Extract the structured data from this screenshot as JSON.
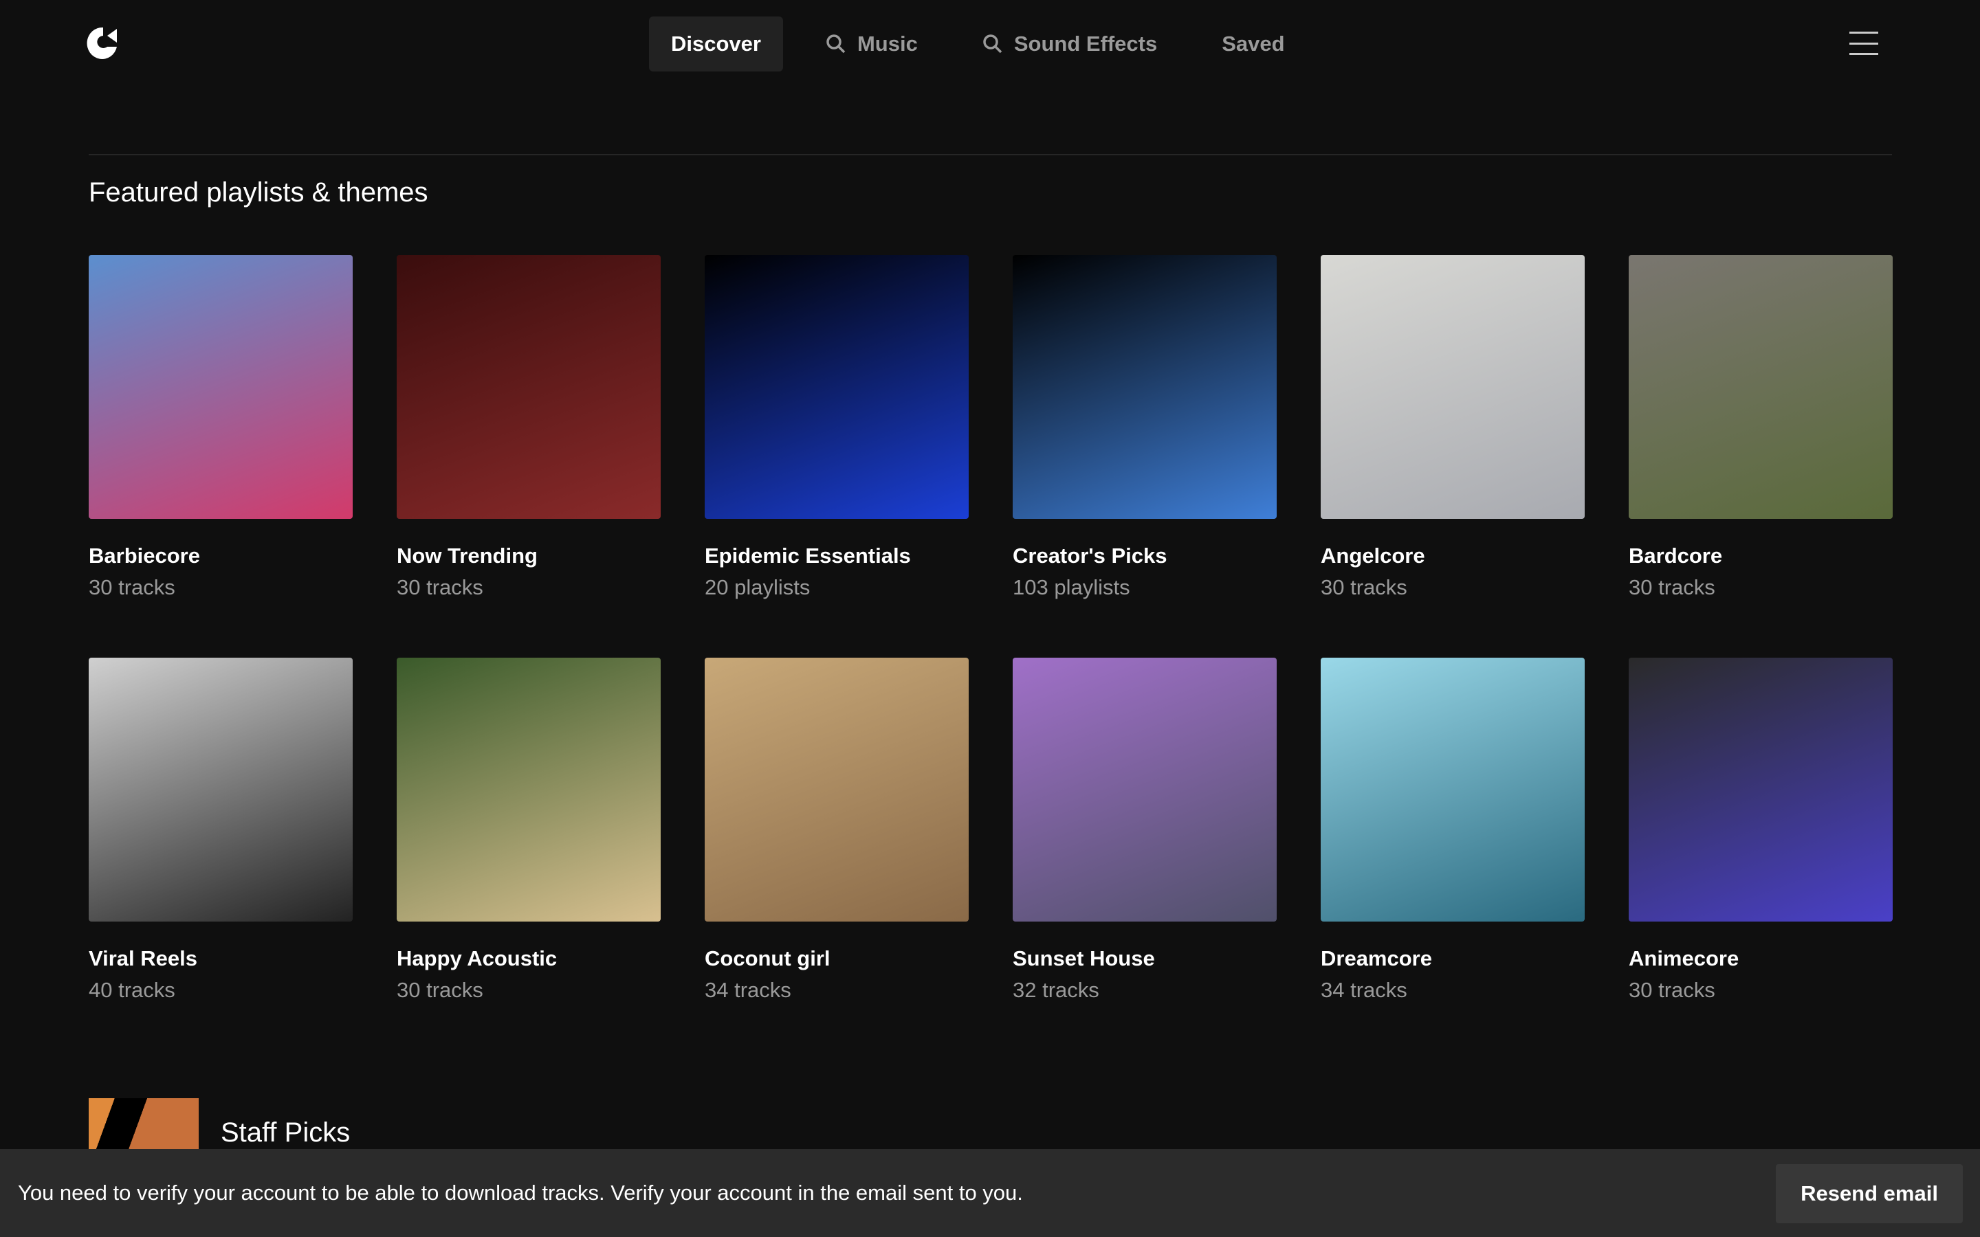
{
  "nav": {
    "items": [
      {
        "label": "Discover",
        "active": true,
        "icon": ""
      },
      {
        "label": "Music",
        "icon": "search-icon"
      },
      {
        "label": "Sound Effects",
        "icon": "search-icon"
      },
      {
        "label": "Saved",
        "icon": ""
      }
    ]
  },
  "featured": {
    "heading": "Featured playlists & themes",
    "cards": [
      {
        "title": "Barbiecore",
        "subtitle": "30 tracks",
        "colors": [
          "#5b8fcf",
          "#d33a6a"
        ]
      },
      {
        "title": "Now Trending",
        "subtitle": "30 tracks",
        "colors": [
          "#3a0d0d",
          "#8a2a2a"
        ]
      },
      {
        "title": "Epidemic Essentials",
        "subtitle": "20 playlists",
        "colors": [
          "#000000",
          "#1b3fd6"
        ]
      },
      {
        "title": "Creator's Picks",
        "subtitle": "103 playlists",
        "colors": [
          "#000000",
          "#3f7fd8"
        ]
      },
      {
        "title": "Angelcore",
        "subtitle": "30 tracks",
        "colors": [
          "#d8d8d4",
          "#a8aab0"
        ]
      },
      {
        "title": "Bardcore",
        "subtitle": "30 tracks",
        "colors": [
          "#7a7670",
          "#5a6a3a"
        ]
      },
      {
        "title": "Viral Reels",
        "subtitle": "40 tracks",
        "colors": [
          "#d0d0d0",
          "#222222"
        ]
      },
      {
        "title": "Happy Acoustic",
        "subtitle": "30 tracks",
        "colors": [
          "#3a5a2a",
          "#d8c090"
        ]
      },
      {
        "title": "Coconut girl",
        "subtitle": "34 tracks",
        "colors": [
          "#c8a878",
          "#8a6a48"
        ]
      },
      {
        "title": "Sunset House",
        "subtitle": "32 tracks",
        "colors": [
          "#a070c8",
          "#50506a"
        ]
      },
      {
        "title": "Dreamcore",
        "subtitle": "34 tracks",
        "colors": [
          "#9ad8e8",
          "#2a6a80"
        ]
      },
      {
        "title": "Animecore",
        "subtitle": "30 tracks",
        "colors": [
          "#2a2a2a",
          "#4a40c8"
        ]
      }
    ]
  },
  "staff": {
    "title": "Staff Picks"
  },
  "banner": {
    "message": "You need to verify your account to be able to download tracks. Verify your account in the email sent to you.",
    "button": "Resend email"
  }
}
